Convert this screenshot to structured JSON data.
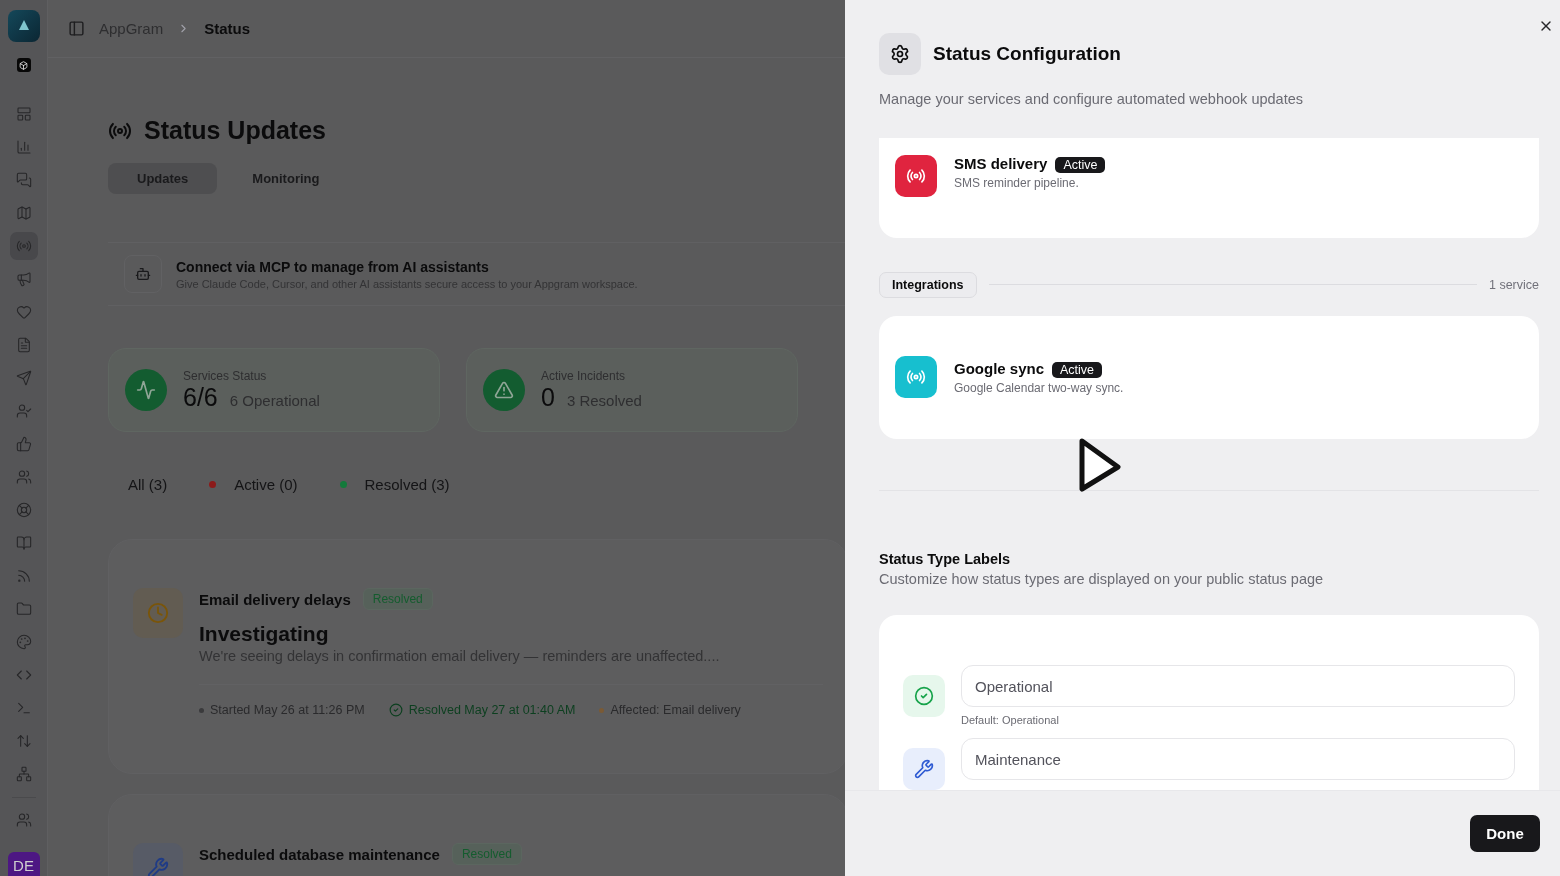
{
  "sidebar": {
    "items": [
      {
        "selected": false
      },
      {
        "selected": false
      },
      {
        "selected": false
      },
      {
        "selected": false
      },
      {
        "selected": true
      },
      {
        "selected": false
      },
      {
        "selected": false
      },
      {
        "selected": false
      },
      {
        "selected": false
      },
      {
        "selected": false
      },
      {
        "selected": false
      },
      {
        "selected": false
      },
      {
        "selected": false
      },
      {
        "selected": false
      },
      {
        "selected": false
      },
      {
        "selected": false
      },
      {
        "selected": false
      },
      {
        "selected": false
      },
      {
        "selected": false
      },
      {
        "selected": false
      },
      {
        "selected": false
      }
    ],
    "avatar": "DE"
  },
  "breadcrumb": [
    "AppGram",
    "Status"
  ],
  "page": {
    "title": "Status Updates"
  },
  "tabs": [
    {
      "label": "Updates",
      "selected": true
    },
    {
      "label": "Monitoring",
      "selected": false
    }
  ],
  "mcp_banner": {
    "title": "Connect via MCP to manage from AI assistants",
    "description": "Give Claude Code, Cursor, and other AI assistants secure access to your Appgram workspace."
  },
  "stats": [
    {
      "kind": "pulse",
      "label": "Services Status",
      "value": "6/6",
      "note": "6 Operational"
    },
    {
      "kind": "warning",
      "label": "Active Incidents",
      "value": "0",
      "note": "3 Resolved"
    }
  ],
  "filters": [
    {
      "label": "All (3)"
    },
    {
      "label": "Active (0)",
      "color": "#8c1a1a"
    },
    {
      "label": "Resolved (3)",
      "color": "#137a3b"
    }
  ],
  "incidents": [
    {
      "kind": "clock",
      "title": "Email delivery delays",
      "badge": "Resolved",
      "status": "Investigating",
      "description": "We're seeing delays in confirmation email delivery — reminders are unaffected....",
      "started": "Started May 26 at 11:26 PM",
      "resolved": "Resolved May 27 at 01:40 AM",
      "affected": "Affected: Email delivery"
    },
    {
      "kind": "wrench",
      "title": "Scheduled database maintenance",
      "badge": "Resolved"
    }
  ],
  "sheet": {
    "title": "Status Configuration",
    "subtitle": "Manage your services and configure automated webhook updates",
    "services": [
      {
        "name": "SMS delivery",
        "badge": "Active",
        "description": "SMS reminder pipeline.",
        "color": "#e0243f"
      }
    ],
    "group": {
      "label": "Integrations",
      "count": "1 service"
    },
    "integrations": [
      {
        "name": "Google sync",
        "badge": "Active",
        "description": "Google Calendar two-way sync.",
        "color": "#17bfcf"
      }
    ],
    "labels_section": {
      "title": "Status Type Labels",
      "description": "Customize how status types are displayed on your public status page"
    },
    "status_labels": [
      {
        "kind": "operational",
        "value": "Operational",
        "hint": "Default: Operational"
      },
      {
        "kind": "maintenance",
        "value": "Maintenance"
      }
    ],
    "done": "Done"
  }
}
